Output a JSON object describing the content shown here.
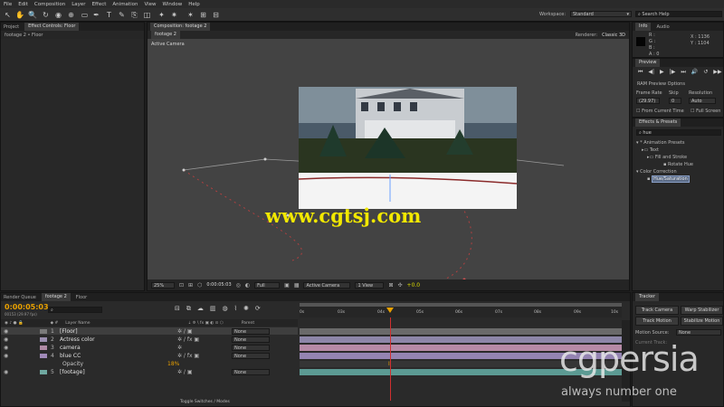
{
  "menu": [
    "File",
    "Edit",
    "Composition",
    "Layer",
    "Effect",
    "Animation",
    "View",
    "Window",
    "Help"
  ],
  "workspace": {
    "label": "Workspace:",
    "value": "Standard"
  },
  "search_help": {
    "placeholder": "Search Help"
  },
  "project_panel": {
    "tabs": [
      "Project",
      "Effect Controls: Floor"
    ],
    "breadcrumb": "footage 2 • Floor"
  },
  "composition_panel": {
    "tab": "Composition: footage 2",
    "comp_tab": "footage 2",
    "renderer_label": "Renderer:",
    "renderer_value": "Classic 3D",
    "camera_label": "Active Camera",
    "zoom": "25%",
    "timecode": "0:00:05:03",
    "resolution": "Full",
    "view_camera": "Active Camera",
    "views": "1 View",
    "exposure": "+0.0"
  },
  "watermark": {
    "url": "www.cgtsj.com",
    "brand": "cgpersia",
    "tagline": "always number one"
  },
  "info_panel": {
    "tabs": [
      "Info",
      "Audio"
    ],
    "r": "R :",
    "g": "G :",
    "b": "B :",
    "a": "A : 0",
    "x": "X : 1136",
    "y": "Y : 1104"
  },
  "preview_panel": {
    "title": "Preview",
    "options": "RAM Preview Options",
    "frame_rate_label": "Frame Rate",
    "skip_label": "Skip",
    "resolution_label": "Resolution",
    "frame_rate": "(29.97)",
    "skip": "0",
    "resolution": "Auto",
    "from_current": "From Current Time",
    "full_screen": "Full Screen"
  },
  "effects_panel": {
    "title": "Effects & Presets",
    "search_value": "hue",
    "items": [
      {
        "label": "* Animation Presets",
        "indent": 0
      },
      {
        "label": "Text",
        "indent": 1
      },
      {
        "label": "Fill and Stroke",
        "indent": 2
      },
      {
        "label": "Rotate Hue",
        "indent": 3
      },
      {
        "label": "Color Correction",
        "indent": 0
      },
      {
        "label": "Hue/Saturation",
        "indent": 1
      }
    ]
  },
  "bottom_tabs": [
    "Render Queue",
    "footage 2",
    "Floor"
  ],
  "timeline": {
    "timecode": "0:00:05:03",
    "frame_info": "00153 (29.97 fps)",
    "col_source": "Layer Name",
    "col_parent": "Parent",
    "layers": [
      {
        "num": "1",
        "name": "[Floor]",
        "parent": "None",
        "color": "#7a7a7a"
      },
      {
        "num": "2",
        "name": "Actress color",
        "parent": "None",
        "color": "#9b8fb0"
      },
      {
        "num": "3",
        "name": "camera",
        "parent": "None",
        "color": "#b08aa5"
      },
      {
        "num": "4",
        "name": "blue CC",
        "parent": "None",
        "color": "#a08ab8"
      },
      {
        "num": "5",
        "name": "[footage]",
        "parent": "None",
        "color": "#6fa8a0"
      }
    ],
    "opacity_label": "Opacity",
    "opacity_value": "18%",
    "ruler": [
      "0s",
      "03s",
      "04s",
      "05s",
      "06s",
      "07s",
      "08s",
      "09s",
      "10s"
    ],
    "toggle_label": "Toggle Switches / Modes"
  },
  "tracker_panel": {
    "title": "Tracker",
    "track_camera": "Track Camera",
    "warp_stabilizer": "Warp Stabilizer",
    "track_motion": "Track Motion",
    "stabilize_motion": "Stabilize Motion",
    "motion_source_label": "Motion Source:",
    "motion_source_value": "None",
    "current_track": "Current Track:"
  }
}
